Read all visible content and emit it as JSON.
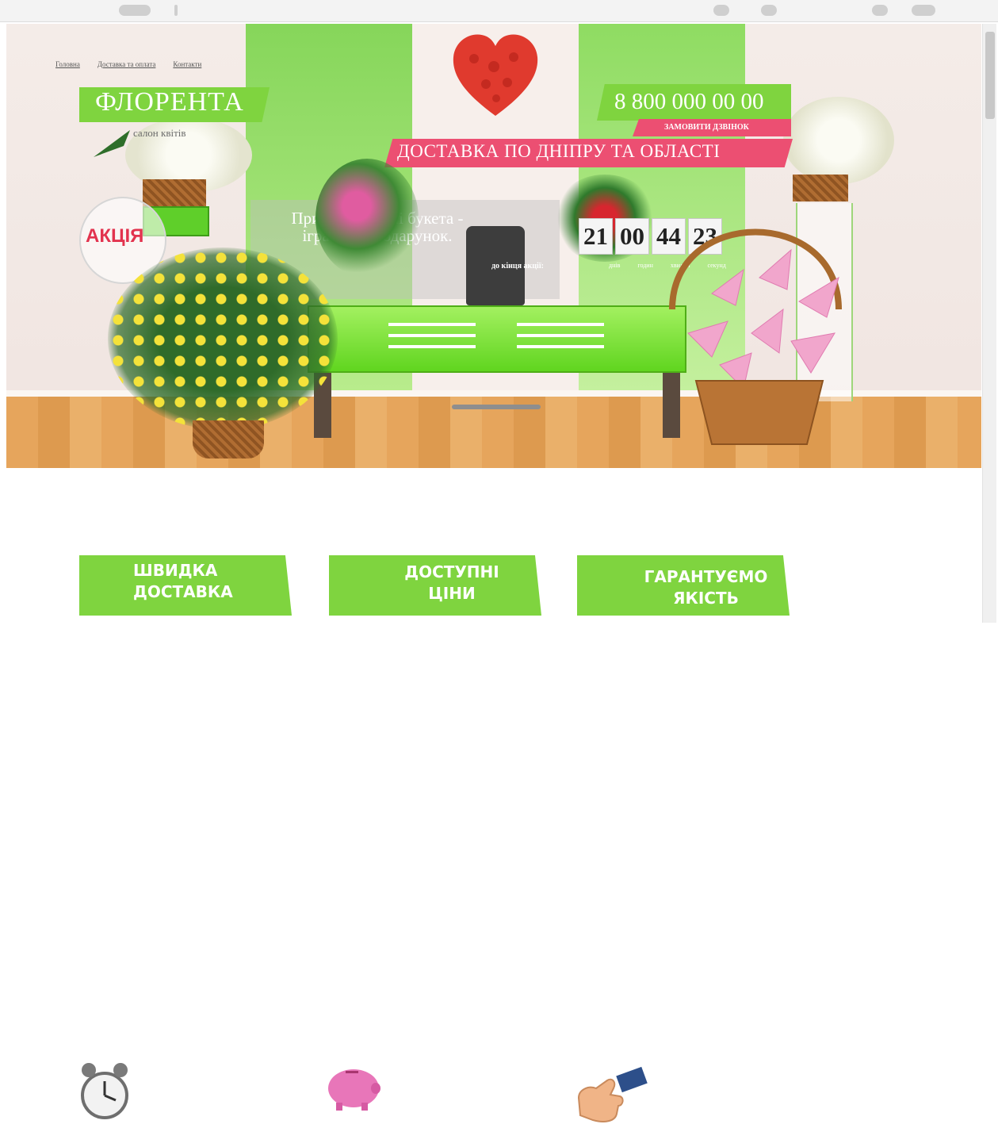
{
  "nav": {
    "items": [
      {
        "label": "Головна"
      },
      {
        "label": "Доставка та оплата"
      },
      {
        "label": "Контакти"
      }
    ]
  },
  "brand": {
    "name": "ФЛОРЕНТА",
    "tagline": "салон квітів"
  },
  "contact": {
    "phone": "8 800 000 00 00",
    "callback_label": "ЗАМОВИТИ ДЗВІНОК"
  },
  "banner": {
    "delivery": "ДОСТАВКА ПО ДНІПРУ ТА ОБЛАСТІ"
  },
  "promo": {
    "label": "АКЦІЯ",
    "text_line1": "При замовленні букета -",
    "text_line2": "іграшка в подарунок."
  },
  "timer": {
    "days": "21",
    "hours": "00",
    "minutes": "44",
    "seconds": "23",
    "caption": "до кінця акції:",
    "unit_days": "днів",
    "unit_hours": "годин",
    "unit_minutes": "хвилин",
    "unit_seconds": "секунд"
  },
  "features": [
    {
      "line1": "ШВИДКА",
      "line2": "ДОСТАВКА"
    },
    {
      "line1": "ДОСТУПНІ",
      "line2": "ЦІНИ"
    },
    {
      "line1": "ГАРАНТУЄМО",
      "line2": "ЯКІСТЬ"
    }
  ],
  "icons": [
    "alarm-clock-icon",
    "piggy-bank-icon",
    "thumbs-up-icon"
  ],
  "colors": {
    "accent_green": "#7fd43f",
    "accent_pink": "#ec4f72",
    "text_white": "#ffffff"
  }
}
